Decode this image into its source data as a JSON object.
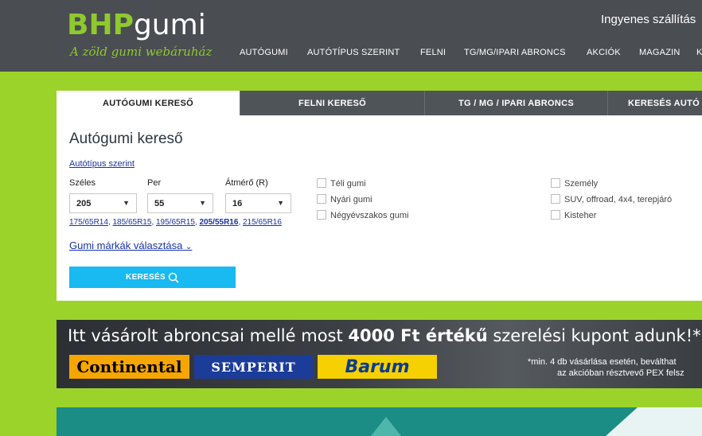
{
  "header": {
    "logo_bhp": "BHP",
    "logo_gumi": "gumi",
    "tagline": "A zöld gumi webáruház",
    "promo": "Ingyenes szállítás",
    "nav": [
      "AUTÓGUMI",
      "AUTÓTÍPUS SZERINT",
      "FELNI",
      "TG/MG/IPARI ABRONCS",
      "AKCIÓK",
      "MAGAZIN",
      "K"
    ]
  },
  "tabs": [
    "AUTÓGUMI KERESŐ",
    "FELNI KERESŐ",
    "TG / MG / IPARI ABRONCS",
    "KERESÉS AUTÓ"
  ],
  "search": {
    "title": "Autógumi kereső",
    "type_link": "Autótípus szerint",
    "width_label": "Széles",
    "profile_label": "Per",
    "diameter_label": "Átmérő (R)",
    "width_value": "205",
    "profile_value": "55",
    "diameter_value": "16",
    "quick_sizes": [
      "175/65R14",
      "185/65R15",
      "195/65R15",
      "205/55R16",
      "215/65R16"
    ],
    "seasons": [
      "Téli gumi",
      "Nyári gumi",
      "Négyévszakos gumi"
    ],
    "vehicle_types": [
      "Személy",
      "SUV, offroad, 4x4, terepjáró",
      "Kisteher"
    ],
    "brands_link": "Gumi márkák választása",
    "search_button": "KERESÉS"
  },
  "banner": {
    "text_before": "Itt vásárolt abroncsai mellé most ",
    "text_bold": "4000 Ft értékű",
    "text_after": " szerelési kupont adunk!*",
    "brand1": "Continental",
    "brand2": "SEMPERIT",
    "brand3": "Barum",
    "fine1": "*min. 4 db vásárlása esetén, beválthat",
    "fine2": "az akcióban résztvevő PEX felsz"
  },
  "colors": {
    "page_bg": "#9cd32b",
    "header_bg": "#4a4d52",
    "brand_green": "#8fc92e",
    "accent_blue": "#19b9f1",
    "link_blue": "#1a33a8"
  }
}
